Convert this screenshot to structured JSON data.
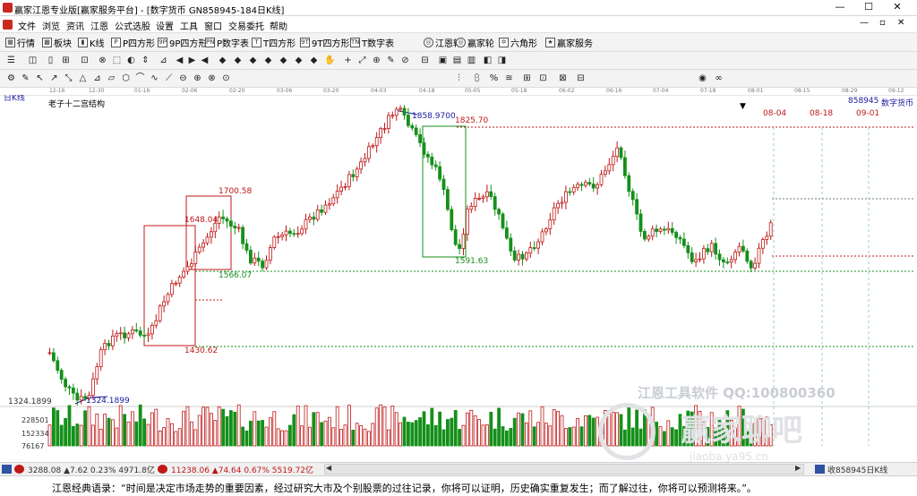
{
  "window": {
    "title": "赢家江恩专业版[赢家服务平台] - [数字货币 GN858945-184日K线]",
    "controls": [
      "—",
      "☐",
      "✕"
    ]
  },
  "menu": {
    "items": [
      "文件",
      "浏览",
      "资讯",
      "江恩",
      "公式选股",
      "设置",
      "工具",
      "窗口",
      "交易委托",
      "帮助"
    ],
    "mdi_controls": [
      "—",
      "▫",
      "✕"
    ]
  },
  "toolbar1": {
    "items": [
      {
        "label": "行情",
        "icon": "grid-icon",
        "glyph": "▦"
      },
      {
        "label": "板块",
        "icon": "blocks-icon",
        "glyph": "▩"
      },
      {
        "label": "K线",
        "icon": "candles-icon",
        "glyph": "▮"
      },
      {
        "label": "P四方形",
        "icon": "p-square-icon",
        "glyph": "P"
      },
      {
        "label": "9P四方形",
        "icon": "9p-square-icon",
        "glyph": "9P"
      },
      {
        "label": "P数字表",
        "icon": "p-table-icon",
        "glyph": "PN"
      },
      {
        "label": "T四方形",
        "icon": "t-square-icon",
        "glyph": "T"
      },
      {
        "label": "9T四方形",
        "icon": "9t-square-icon",
        "glyph": "9T"
      },
      {
        "label": "T数字表",
        "icon": "t-table-icon",
        "glyph": "TN"
      },
      {
        "label": "江恩轮",
        "icon": "gann-wheel-icon",
        "glyph": "◎"
      },
      {
        "label": "赢家轮",
        "icon": "winner-wheel-icon",
        "glyph": "◎"
      },
      {
        "label": "六角形",
        "icon": "hexagon-icon",
        "glyph": "✡"
      },
      {
        "label": "赢家服务",
        "icon": "service-icon",
        "glyph": "★"
      }
    ]
  },
  "chart": {
    "period_label": "日K线",
    "structure_label": "老子十二宫结构",
    "symbol": "858945",
    "market": "数字货币",
    "dates": [
      "12-16",
      "12-30",
      "01-16",
      "02-06",
      "02-20",
      "03-06",
      "03-20",
      "04-03",
      "04-18",
      "05-05",
      "05-18",
      "06-02",
      "06-16",
      "07-04",
      "07-18",
      "08-01",
      "08-15",
      "08-29",
      "09-12"
    ],
    "future_dates": [
      "08-04",
      "08-18",
      "09-01"
    ],
    "price_labels": [
      {
        "text": "1858.9700",
        "color": "#1a1aa0"
      },
      {
        "text": "1825.70",
        "color": "#c01818"
      },
      {
        "text": "1700.58",
        "color": "#c01818"
      },
      {
        "text": "1648.04",
        "color": "#c01818"
      },
      {
        "text": "1566.07",
        "color": "#15901a"
      },
      {
        "text": "1591.63",
        "color": "#15901a"
      },
      {
        "text": "1430.62",
        "color": "#c01818"
      },
      {
        "text": "1324.1899",
        "color": "#1a1aa0"
      }
    ],
    "axis_price": "1324.1899",
    "volume_axis": [
      "228501",
      "152334",
      "76167"
    ],
    "watermark_main": "江恩工具软件 QQ:100800360",
    "watermark_logo": "赢家聊吧",
    "watermark_sub": "jiaoba.ya95.cn",
    "colors": {
      "up": "#c01818",
      "down": "#15901a",
      "box_red": "#c01818",
      "box_green": "#15901a",
      "blue": "#1a1aa0",
      "grid": "#9ad0d0"
    }
  },
  "statusbar": {
    "index1": "3288.08 ▲7.62 0.23% 4971.8亿",
    "index2": "11238.06 ▲74.64 0.67% 5519.72亿",
    "right_text": "收858945日K线"
  },
  "quote": {
    "text": "江恩经典语录：“时间是决定市场走势的重要因素，经过研究大市及个别股票的过往记录，你将可以证明，历史确实重复发生；而了解过往，你将可以预测将来。”。"
  }
}
